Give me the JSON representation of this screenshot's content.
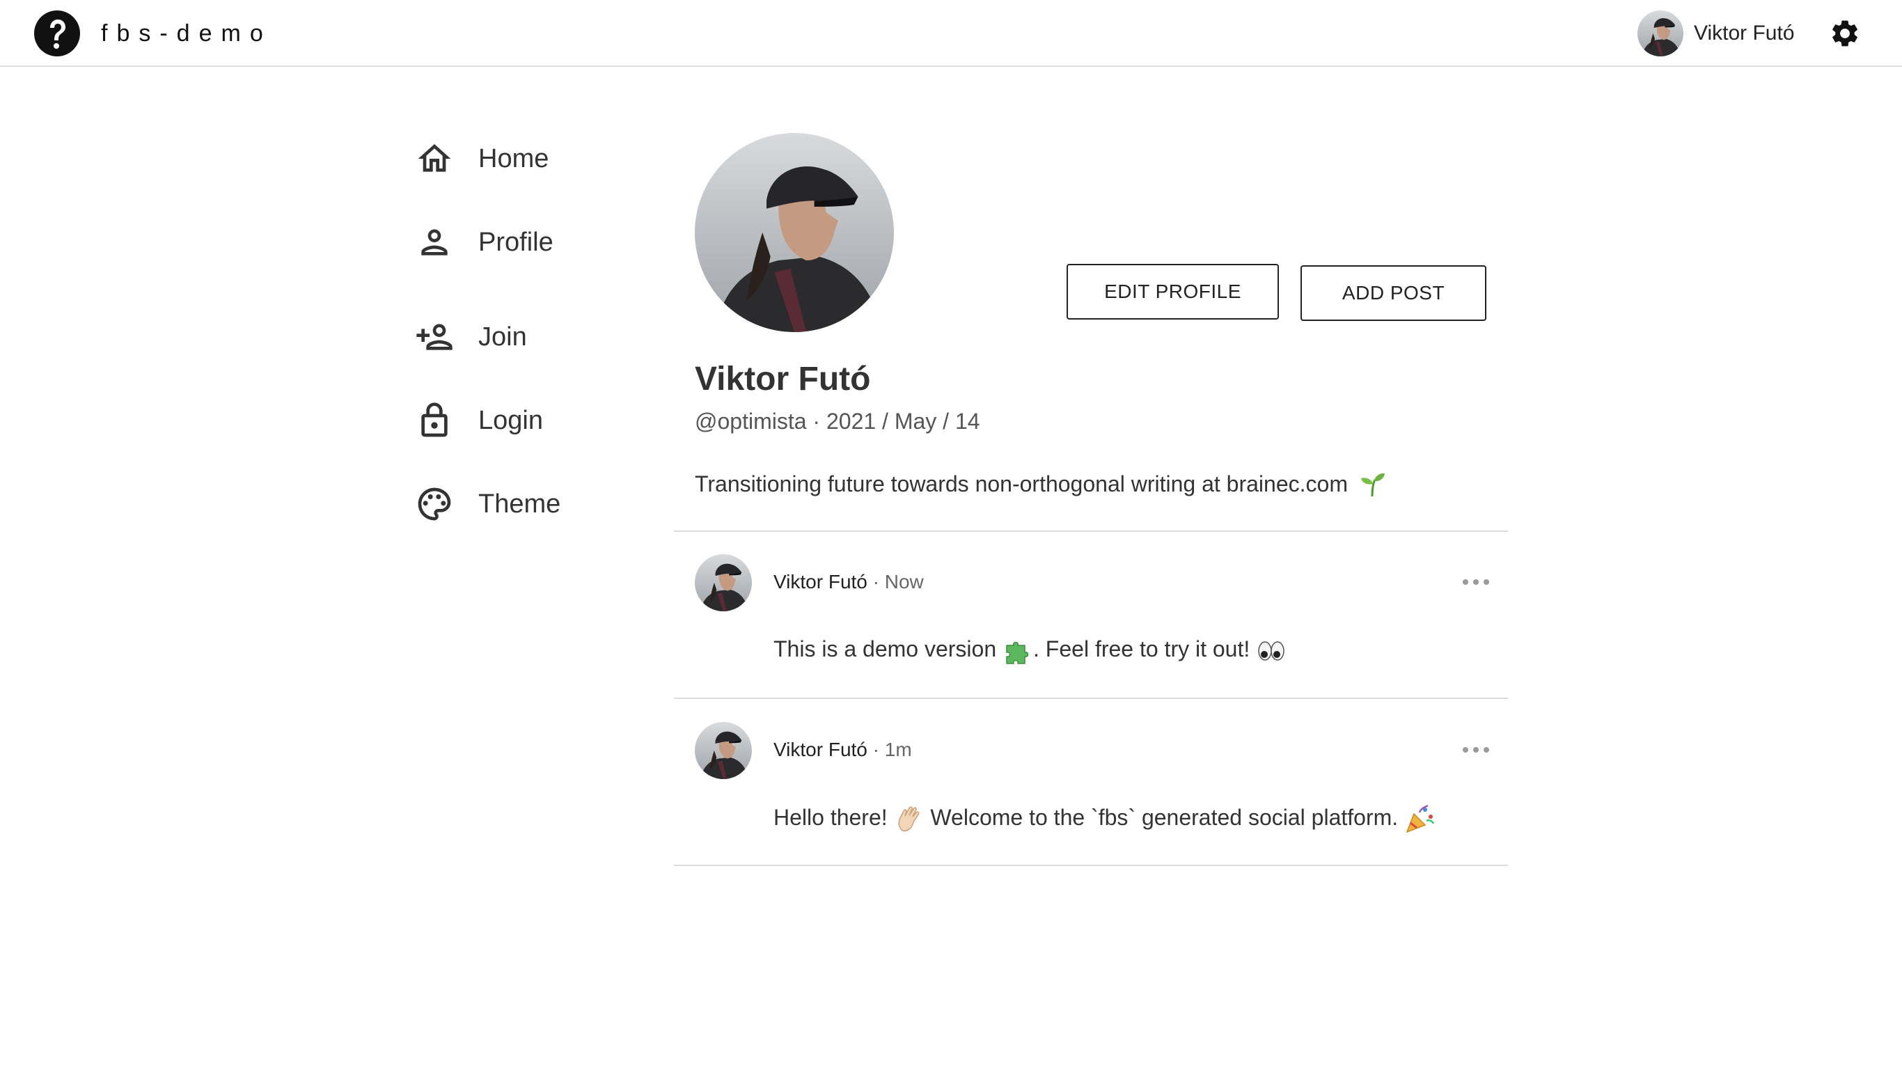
{
  "app": {
    "name": "fbs-demo",
    "logo_icon": "help-circle-icon"
  },
  "header": {
    "username": "Viktor Futó",
    "settings_icon": "gear-icon"
  },
  "sidebar": {
    "items": [
      {
        "label": "Home",
        "icon": "home-icon"
      },
      {
        "label": "Profile",
        "icon": "person-icon"
      },
      {
        "label": "Join",
        "icon": "person-add-icon"
      },
      {
        "label": "Login",
        "icon": "lock-icon"
      },
      {
        "label": "Theme",
        "icon": "palette-icon"
      }
    ]
  },
  "profile": {
    "name": "Viktor Futó",
    "handle": "@optimista",
    "joined": "2021 / May / 14",
    "bio": "Transitioning future towards non-orthogonal writing at brainec.com",
    "edit_label": "EDIT PROFILE",
    "add_post_label": "ADD POST"
  },
  "posts": [
    {
      "author": "Viktor Futó",
      "time": "Now",
      "text_before": "This is a demo version",
      "text_middle": ". Feel free to try it out!",
      "emoji_1": "puzzle-icon",
      "emoji_2": "eyes-icon"
    },
    {
      "author": "Viktor Futó",
      "time": "1m",
      "text_before": "Hello there!",
      "text_middle": "Welcome to the `fbs` generated social platform.",
      "emoji_1": "waving-hand-icon",
      "emoji_2": "party-popper-icon"
    }
  ],
  "colors": {
    "text": "#333333",
    "border": "#222222",
    "divider": "#dcdcdc"
  }
}
